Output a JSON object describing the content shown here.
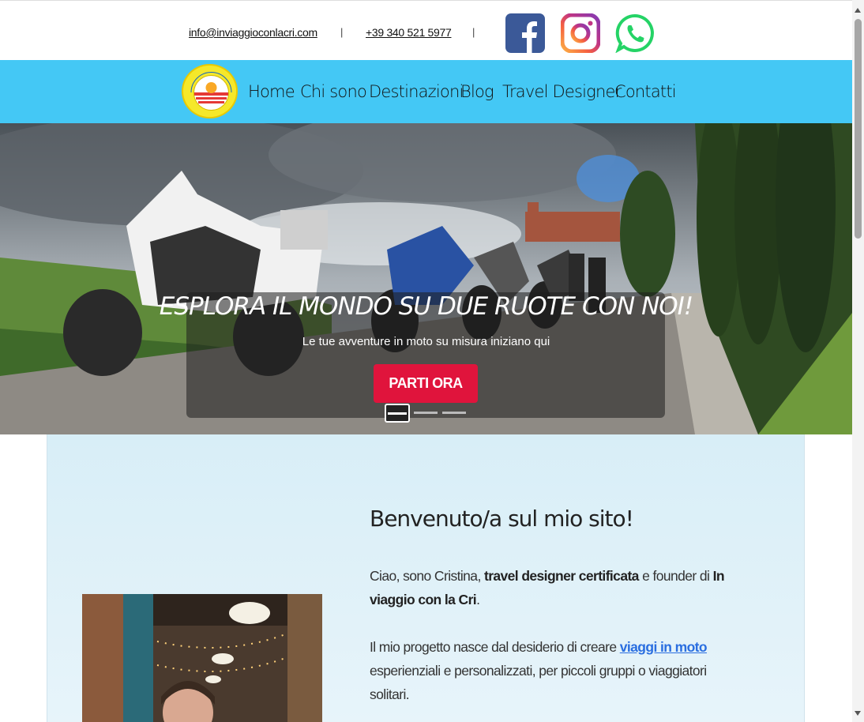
{
  "topbar": {
    "email": "info@inviaggioconlacri.com",
    "phone": "+39 340 521 5977",
    "separator": "|",
    "social": [
      "facebook-icon",
      "instagram-icon",
      "whatsapp-icon"
    ]
  },
  "nav": {
    "logo_text": "IN VIAGGIO CON LA CRI",
    "items": [
      {
        "label": "Home"
      },
      {
        "label": "Chi sono"
      },
      {
        "label": "Destinazioni"
      },
      {
        "label": "Blog"
      },
      {
        "label": "Travel Designer"
      },
      {
        "label": "Contatti"
      }
    ],
    "background": "#44c8f5"
  },
  "hero": {
    "title": "ESPLORA IL MONDO SU DUE RUOTE CON NOI!",
    "subtitle": "Le tue avventure in moto su misura iniziano qui",
    "button": "PARTI ORA",
    "button_color": "#e0143c",
    "slides": 3,
    "active_slide": 1
  },
  "welcome": {
    "title": "Benvenuto/a sul mio sito!",
    "p1_a": "Ciao, sono Cristina, ",
    "p1_b": "travel designer certificata",
    "p1_c": " e founder di ",
    "p1_d": "In viaggio con la Cri",
    "p1_e": ".",
    "p2_a": "Il mio progetto nasce dal desiderio di creare ",
    "p2_link": "viaggi in moto",
    "p2_b": " esperienziali e personalizzati, per piccoli gruppi o viaggiatori solitari."
  }
}
